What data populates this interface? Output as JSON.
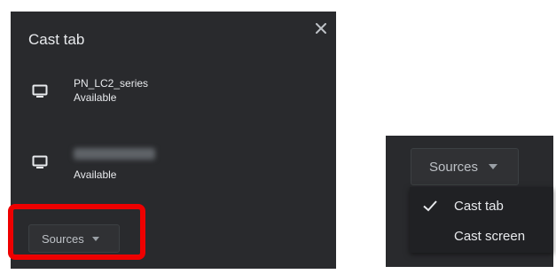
{
  "left_dialog": {
    "title": "Cast tab",
    "close_glyph": "×",
    "sinks": [
      {
        "name": "PN_LC2_series",
        "status": "Available",
        "icon": "monitor-icon"
      },
      {
        "name": "",
        "status": "Available",
        "icon": "monitor-icon",
        "name_blurred": true
      }
    ],
    "sources_label": "Sources",
    "highlight_color": "#ee0000"
  },
  "right_panel": {
    "sources_label": "Sources",
    "menu_items": [
      {
        "label": "Cast tab",
        "checked": true
      },
      {
        "label": "Cast screen",
        "checked": false
      }
    ]
  },
  "colors": {
    "dialog_bg": "#292a2d",
    "dropdown_bg": "#202124",
    "text": "#e8eaed",
    "muted_text": "#bdc1c6"
  }
}
